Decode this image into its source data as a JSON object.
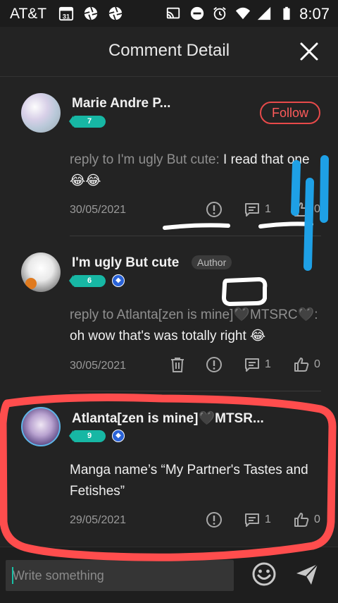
{
  "status_bar": {
    "carrier": "AT&T",
    "calendar_day": "31",
    "time": "8:07",
    "icons": [
      "calendar-icon",
      "aperture-icon",
      "aperture-icon",
      "cast-icon",
      "do-not-disturb-icon",
      "alarm-icon",
      "wifi-icon",
      "signal-icon",
      "battery-icon"
    ]
  },
  "header": {
    "title": "Comment Detail",
    "close_icon": "close-icon"
  },
  "comments": [
    {
      "username": "Marie Andre P...",
      "level": "7",
      "follow_label": "Follow",
      "reply_prefix": "reply to I'm ugly But cute:",
      "text": " I read that one 😂😂",
      "date": "30/05/2021",
      "reply_count": "1",
      "like_count": "0"
    },
    {
      "username": "I'm ugly But cute",
      "author_tag": "Author",
      "level": "6",
      "reply_prefix": "reply to Atlanta[zen is mine]🖤MTSRC🖤:",
      "text": " oh wow that's was totally right 😂",
      "date": "30/05/2021",
      "reply_count": "1",
      "like_count": "0"
    },
    {
      "username": "Atlanta[zen is mine]🖤MTSR...",
      "level": "9",
      "text": "Manga name’s “My Partner's Tastes and Fetishes”",
      "date": "29/05/2021",
      "reply_count": "1",
      "like_count": "0"
    }
  ],
  "composer": {
    "placeholder": "Write something"
  },
  "colors": {
    "background": "#232323",
    "accent": "#17b7a4",
    "follow": "#e84a4a",
    "annotation_red": "#ff4d4d",
    "annotation_blue": "#1ea0e6"
  }
}
